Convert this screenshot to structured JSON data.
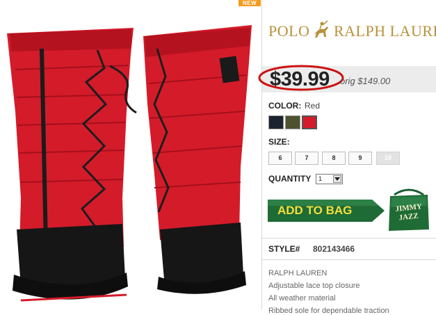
{
  "badge": {
    "label": "NEW"
  },
  "brand": {
    "word1": "POLO",
    "word2": "RALPH LAUREN",
    "logo_icon": "polo-player-icon",
    "color": "#b8923b"
  },
  "pricing": {
    "sale_price": "$39.99",
    "original_price": "orig $149.00",
    "highlight_color": "#cc1111"
  },
  "color": {
    "label": "COLOR:",
    "selected": "Red",
    "swatches": [
      {
        "name": "navy",
        "hex": "#1b2330"
      },
      {
        "name": "olive",
        "hex": "#4f5230"
      },
      {
        "name": "red",
        "hex": "#d51c2b"
      }
    ]
  },
  "size": {
    "label": "SIZE:",
    "options": [
      "6",
      "7",
      "8",
      "9",
      "10"
    ],
    "unavailable": [
      "10"
    ]
  },
  "quantity": {
    "label": "QUANTITY",
    "value": "1"
  },
  "cart": {
    "add_label": "ADD TO BAG",
    "bag_brand": "JIMMY JAZZ",
    "button_color": "#1f6b35"
  },
  "style": {
    "label": "STYLE#",
    "value": "802143466"
  },
  "description": [
    "RALPH LAUREN",
    "Adjustable lace top closure",
    "All weather material",
    "Ribbed sole for dependable traction"
  ]
}
